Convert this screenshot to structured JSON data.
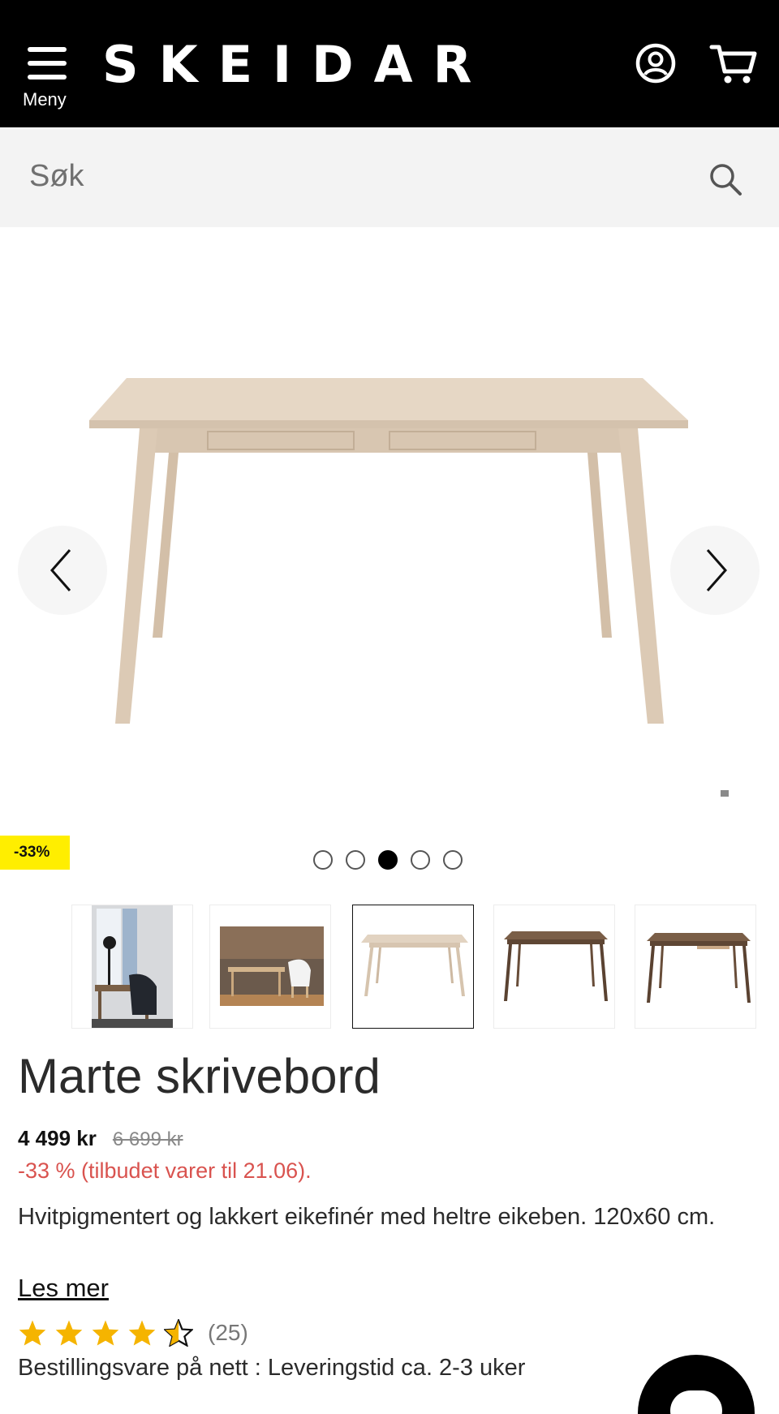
{
  "header": {
    "menu_label": "Meny",
    "logo": "SKEIDAR",
    "account_icon": "account-circle-icon",
    "cart_icon": "cart-icon",
    "background": "#000000"
  },
  "search": {
    "placeholder": "Søk",
    "icon": "search-icon"
  },
  "gallery": {
    "discount_badge": "-33%",
    "badge_color": "#ffee00",
    "dot_count": 5,
    "active_dot": 3,
    "thumbnails": [
      "room-scene-1",
      "room-scene-2",
      "desk-white-oak",
      "desk-dark-1",
      "desk-dark-2"
    ],
    "selected_thumbnail": 3
  },
  "product": {
    "title": "Marte skrivebord",
    "price": "4 499 kr",
    "old_price": "6 699 kr",
    "offer": "-33 % (tilbudet varer til 21.06).",
    "description": "Hvitpigmentert og lakkert eikefinér med heltre eikeben. 120x60 cm.",
    "read_more": "Les mer",
    "rating_value": 4.5,
    "rating_count": "(25)",
    "delivery": "Bestillingsvare på nett : Leveringstid ca. 2-3 uker"
  },
  "colors": {
    "offer_red": "#d9534f",
    "star": "#f5b400"
  }
}
